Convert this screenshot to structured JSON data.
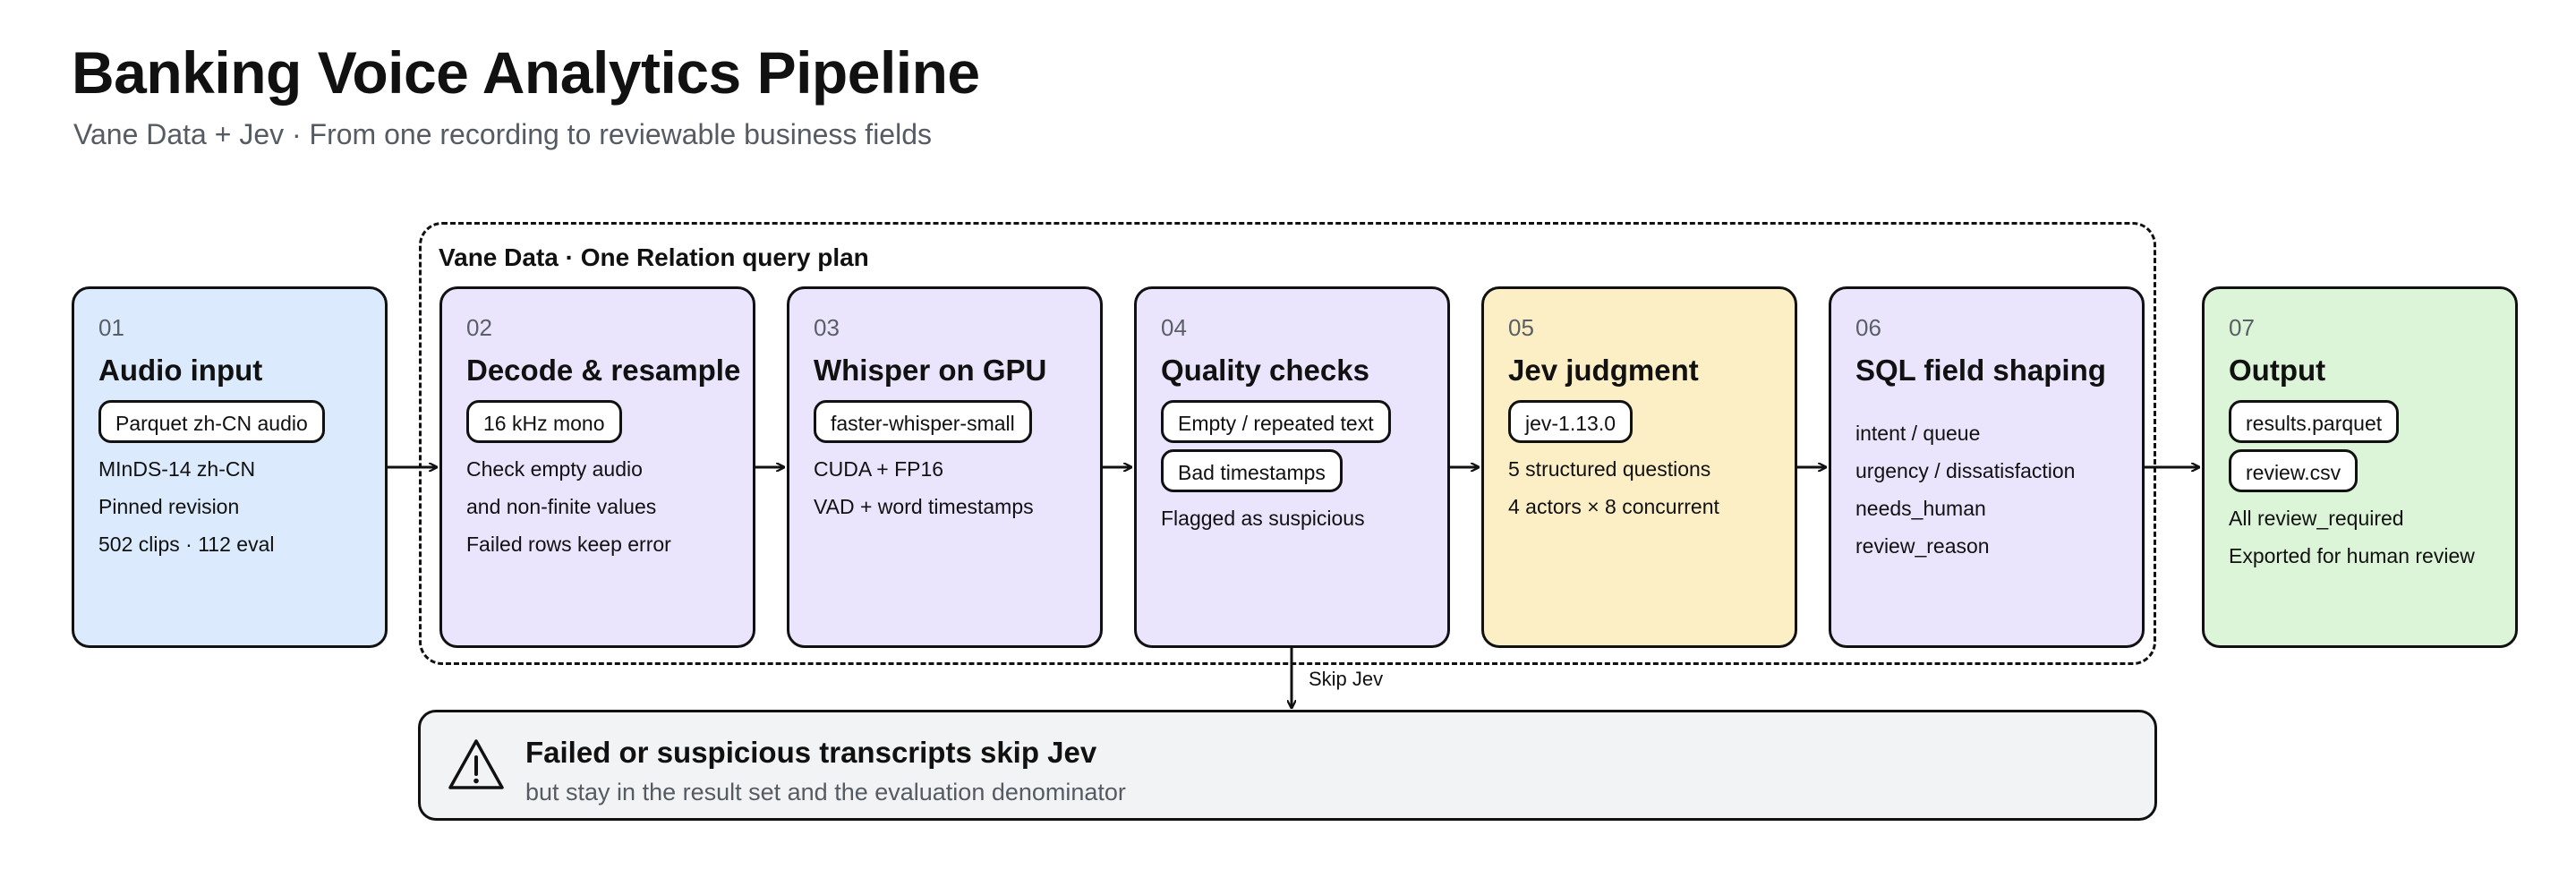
{
  "header": {
    "title": "Banking Voice Analytics Pipeline",
    "subtitle": "Vane Data + Jev · From one recording to reviewable business fields"
  },
  "group": {
    "label": "Vane Data · One Relation query plan"
  },
  "stages": [
    {
      "num": "01",
      "title": "Audio input",
      "color": "#dbeafc",
      "chips": [
        "Parquet zh-CN audio"
      ],
      "lines": [
        "MInDS-14 zh-CN",
        "Pinned revision",
        "502 clips · 112 eval"
      ]
    },
    {
      "num": "02",
      "title": "Decode & resample",
      "color": "#ebe4fd",
      "chips": [
        "16 kHz mono"
      ],
      "lines": [
        "Check empty audio",
        "and non-finite values",
        "Failed rows keep error"
      ]
    },
    {
      "num": "03",
      "title": "Whisper on GPU",
      "color": "#ebe4fd",
      "chips": [
        "faster-whisper-small"
      ],
      "lines": [
        "CUDA + FP16",
        "VAD + word timestamps"
      ]
    },
    {
      "num": "04",
      "title": "Quality checks",
      "color": "#ebe4fd",
      "chips": [
        "Empty / repeated text",
        "Bad timestamps"
      ],
      "lines": [
        "Flagged as suspicious"
      ]
    },
    {
      "num": "05",
      "title": "Jev judgment",
      "color": "#fcefc6",
      "chips": [
        "jev-1.13.0"
      ],
      "lines": [
        "5 structured questions",
        "4 actors × 8 concurrent"
      ]
    },
    {
      "num": "06",
      "title": "SQL field shaping",
      "color": "#ebe4fd",
      "chips": [],
      "lines": [
        "intent / queue",
        "urgency / dissatisfaction",
        "needs_human",
        "review_reason"
      ]
    },
    {
      "num": "07",
      "title": "Output",
      "color": "#dcf5d8",
      "chips": [
        "results.parquet",
        "review.csv"
      ],
      "lines": [
        "All review_required",
        "Exported for human review"
      ]
    }
  ],
  "skip": {
    "label": "Skip Jev"
  },
  "note": {
    "icon": "warning-icon",
    "title": "Failed or suspicious transcripts skip Jev",
    "subtitle": "but stay in the result set and the evaluation denominator"
  }
}
